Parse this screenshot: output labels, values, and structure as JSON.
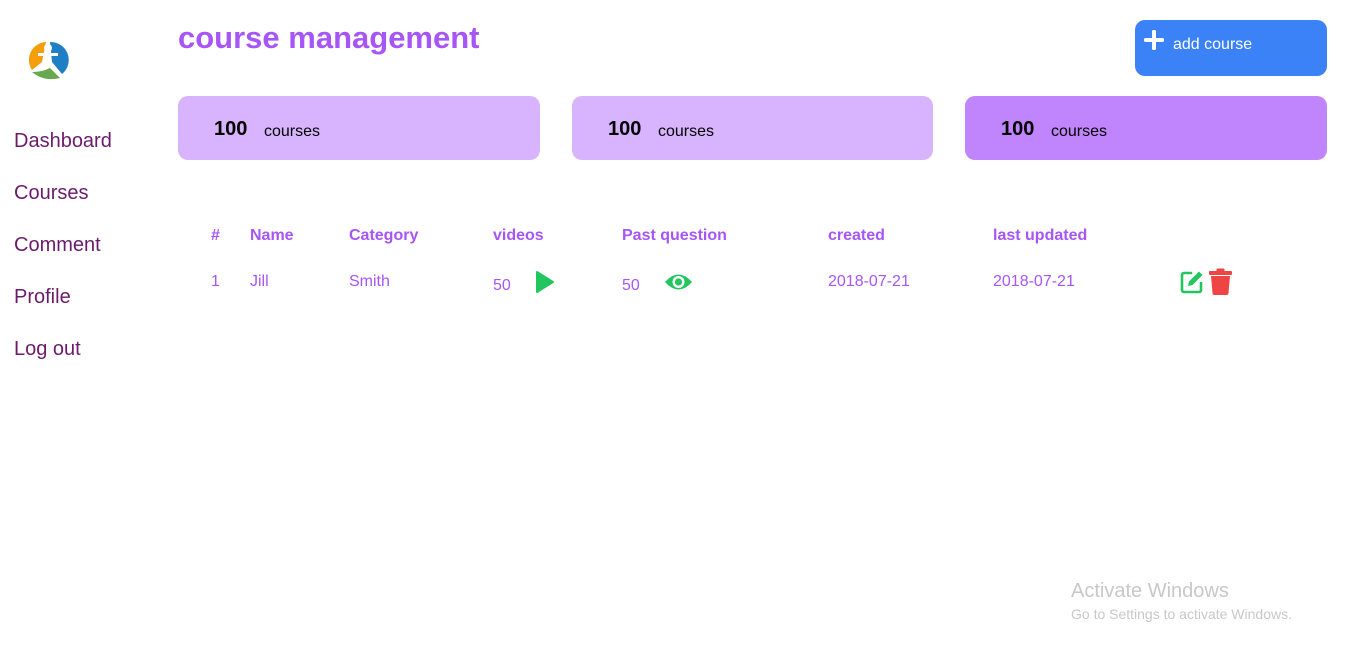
{
  "sidebar": {
    "logo_icon": "person-logo-icon",
    "items": [
      {
        "label": "Dashboard"
      },
      {
        "label": "Courses"
      },
      {
        "label": "Comment"
      },
      {
        "label": "Profile"
      },
      {
        "label": "Log out"
      }
    ]
  },
  "header": {
    "title": "course management",
    "add_button": {
      "label": "add course",
      "icon": "plus-icon"
    }
  },
  "stats": [
    {
      "value": "100",
      "label": "courses"
    },
    {
      "value": "100",
      "label": "courses"
    },
    {
      "value": "100",
      "label": "courses"
    }
  ],
  "table": {
    "headers": [
      "#",
      "Name",
      "Category",
      "videos",
      "Past question",
      "created",
      "last updated"
    ],
    "rows": [
      {
        "index": "1",
        "name": "Jill",
        "category": "Smith",
        "videos": "50",
        "past_questions": "50",
        "created": "2018-07-21",
        "last_updated": "2018-07-21"
      }
    ]
  },
  "colors": {
    "accent": "#a855f7",
    "nav_text": "#6b1b6b",
    "button": "#3b82f6",
    "card_light": "#d8b4fe",
    "card_dark": "#c084fc",
    "success": "#22c55e",
    "danger": "#ef4444"
  },
  "watermark": {
    "title": "Activate Windows",
    "subtitle": "Go to Settings to activate Windows."
  }
}
